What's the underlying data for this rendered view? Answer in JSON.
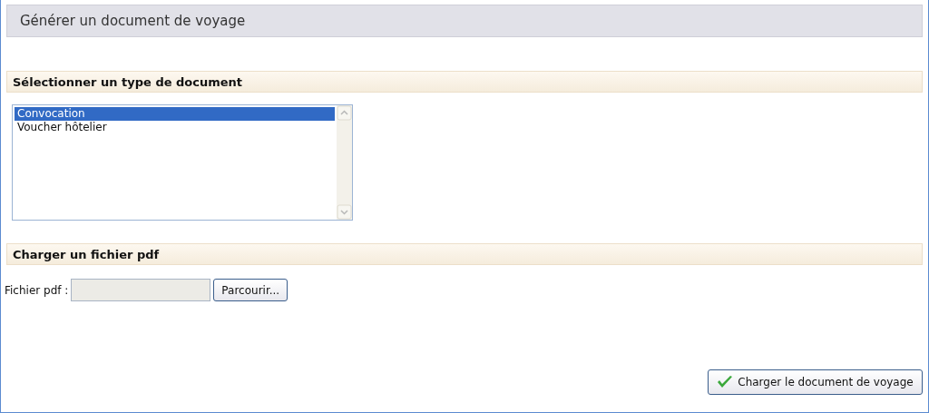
{
  "title": "Générer un document de voyage",
  "sections": [
    {
      "heading": "Sélectionner un type de document",
      "kind": "listbox",
      "options": [
        {
          "label": "Convocation",
          "selected": true
        },
        {
          "label": "Voucher hôtelier",
          "selected": false
        }
      ]
    },
    {
      "heading": "Charger un fichier pdf",
      "kind": "file",
      "label": "Fichier pdf :",
      "button": "Parcourir..."
    }
  ],
  "submit": {
    "label": "Charger le document de voyage"
  }
}
